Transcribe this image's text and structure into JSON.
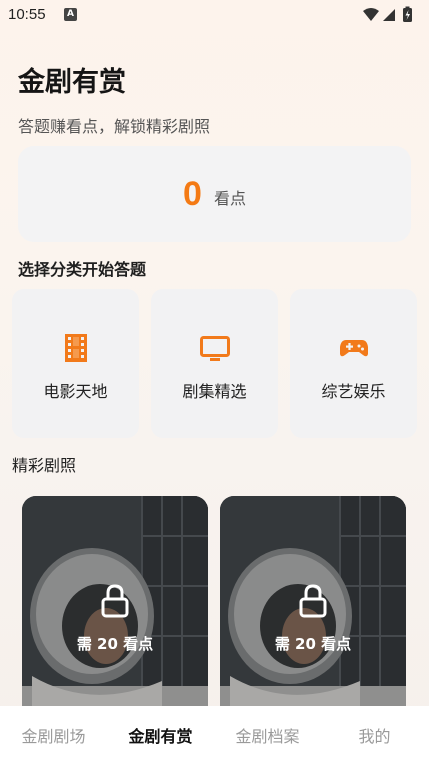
{
  "status_bar": {
    "time": "10:55",
    "notification": "A"
  },
  "header": {
    "title": "金剧有赏",
    "subtitle": "答题赚看点，解锁精彩剧照"
  },
  "points": {
    "value": "0",
    "unit": "看点",
    "accent_color": "#f47a14"
  },
  "categories": {
    "title": "选择分类开始答题",
    "items": [
      {
        "label": "电影天地",
        "icon": "film-icon"
      },
      {
        "label": "剧集精选",
        "icon": "tv-icon"
      },
      {
        "label": "综艺娱乐",
        "icon": "gamepad-icon"
      }
    ]
  },
  "gallery": {
    "title": "精彩剧照",
    "items": [
      {
        "cost_label": "需 20 看点",
        "icon": "lock-icon"
      },
      {
        "cost_label": "需 20 看点",
        "icon": "lock-icon"
      }
    ]
  },
  "tabbar": {
    "active_index": 1,
    "items": [
      {
        "label": "金剧剧场"
      },
      {
        "label": "金剧有赏"
      },
      {
        "label": "金剧档案"
      },
      {
        "label": "我的"
      }
    ]
  }
}
